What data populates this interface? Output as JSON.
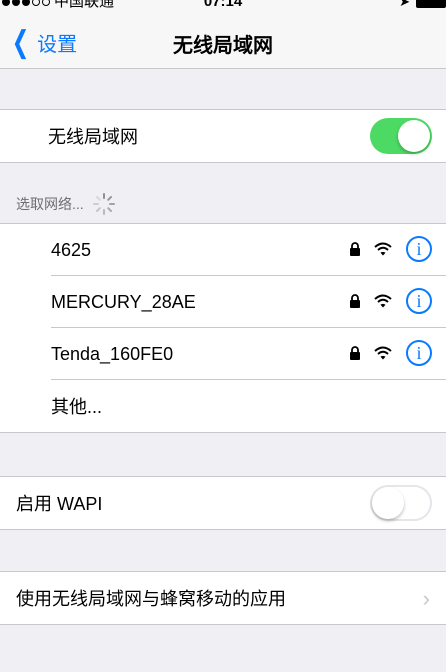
{
  "status_bar": {
    "carrier": "中国联通",
    "time": "07:14"
  },
  "nav": {
    "back_label": "设置",
    "title": "无线局域网"
  },
  "wifi_toggle": {
    "label": "无线局域网",
    "on": true
  },
  "networks_section": {
    "header": "选取网络..."
  },
  "networks": [
    {
      "name": "4625",
      "secured": true
    },
    {
      "name": "MERCURY_28AE",
      "secured": true
    },
    {
      "name": "Tenda_160FE0",
      "secured": true
    }
  ],
  "other_label": "其他...",
  "wapi": {
    "label": "启用 WAPI",
    "on": false
  },
  "apps_row": {
    "label": "使用无线局域网与蜂窝移动的应用"
  },
  "colors": {
    "accent": "#0a7aff",
    "toggle_on": "#4cd964",
    "background": "#efeff4"
  },
  "icons": {
    "lock": "lock-icon",
    "wifi": "wifi-icon",
    "info": "info-icon"
  }
}
